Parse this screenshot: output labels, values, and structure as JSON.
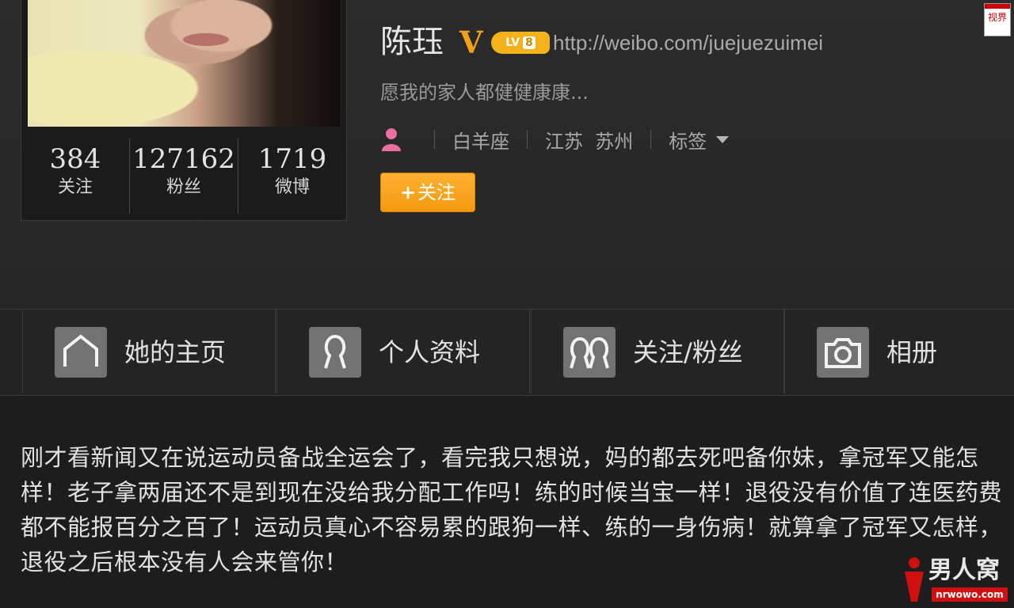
{
  "profile": {
    "name": "陈珏",
    "verified_mark": "V",
    "level_badge": {
      "prefix": "LV",
      "value": "8"
    },
    "url": "http://weibo.com/juejuezuimei",
    "bio": "愿我的家人都健健康康...",
    "zodiac": "白羊座",
    "location": "江苏  苏州",
    "tags_label": "标签",
    "follow_button": "关注",
    "follow_plus": "+"
  },
  "stats": [
    {
      "value": "384",
      "label": "关注"
    },
    {
      "value": "127162",
      "label": "粉丝"
    },
    {
      "value": "1719",
      "label": "微博"
    }
  ],
  "nav": {
    "tabs": [
      {
        "label": "她的主页",
        "icon": "home-icon"
      },
      {
        "label": "个人资料",
        "icon": "person-icon"
      },
      {
        "label": "关注/粉丝",
        "icon": "people-icon"
      },
      {
        "label": "相册",
        "icon": "camera-icon"
      }
    ]
  },
  "post": {
    "text": "刚才看新闻又在说运动员备战全运会了，看完我只想说，妈的都去死吧备你妹，拿冠军又能怎样！老子拿两届还不是到现在没给我分配工作吗！练的时候当宝一样！退役没有价值了连医药费都不能报百分之百了！运动员真心不容易累的跟狗一样、练的一身伤病！就算拿了冠军又怎样，退役之后根本没有人会来管你！"
  },
  "watermarks": {
    "top_right": "视界",
    "bottom_right": "男人窝",
    "bottom_right_sub": "nrwowo.com"
  },
  "colors": {
    "accent_orange": "#f49a10",
    "verified_gold": "#f2a01a",
    "background": "#1d1d1d"
  }
}
